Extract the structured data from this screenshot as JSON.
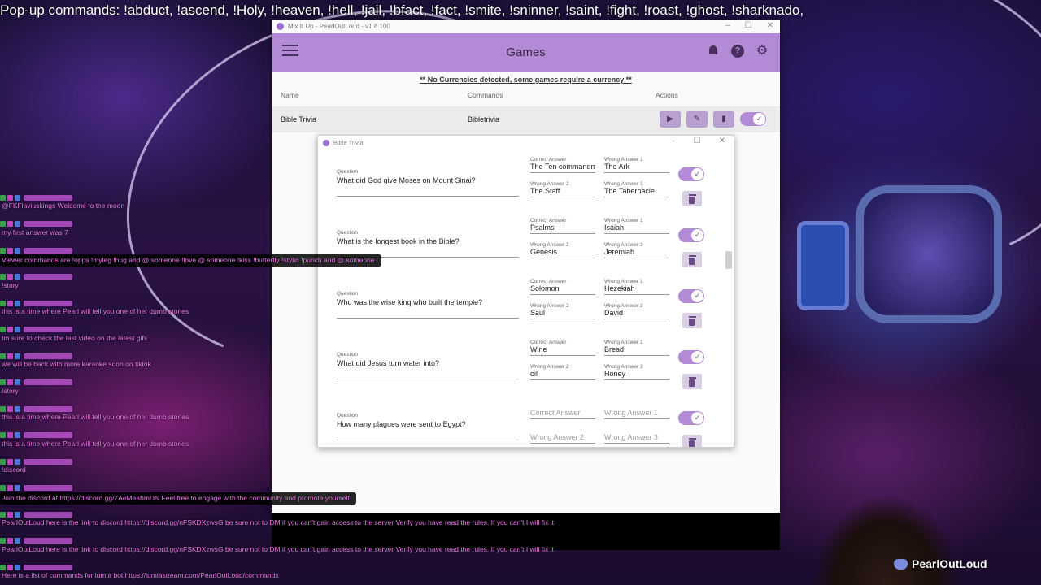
{
  "ticker": "Pop-up commands: !abduct, !ascend, !Holy, !heaven, !hell,  !jail, !bfact, !fact, !smite, !sninner, !saint, !fight, !roast, !ghost, !sharknado,",
  "app": {
    "window_title": "Mix It Up - PearlOutLoud - v1.8.100",
    "header_title": "Games",
    "notice": "** No Currencies detected, some games require a currency **",
    "columns": {
      "name": "Name",
      "commands": "Commands",
      "actions": "Actions"
    },
    "game": {
      "name": "Bible Trivia",
      "command": "Bibletrivia"
    }
  },
  "dialog": {
    "title": "Bible Trivia",
    "labels": {
      "question": "Question",
      "correct": "Correct Answer",
      "wrong1": "Wrong Answer 1",
      "wrong2": "Wrong Answer 2",
      "wrong3": "Wrong Answer 3"
    },
    "questions": [
      {
        "question": "What did God give Moses on Mount Sinai?",
        "correct": "The Ten commandments",
        "wrong1": "The Ark",
        "wrong2": "The Staff",
        "wrong3": "The Tabernacle",
        "enabled": true
      },
      {
        "question": "What is the longest book in the Bible?",
        "correct": "Psalms",
        "wrong1": "Isaiah",
        "wrong2": "Genesis",
        "wrong3": "Jeremiah",
        "enabled": true
      },
      {
        "question": "Who was the wise king who built the temple?",
        "correct": "Solomon",
        "wrong1": "Hezekiah",
        "wrong2": "Saul",
        "wrong3": "David",
        "enabled": true
      },
      {
        "question": "What did Jesus turn water into?",
        "correct": "Wine",
        "wrong1": "Bread",
        "wrong2": "oil",
        "wrong3": "Honey",
        "enabled": true
      },
      {
        "question": "How many plagues were sent to Egypt?",
        "correct": "",
        "wrong1": "",
        "wrong2": "",
        "wrong3": "",
        "enabled": true
      }
    ]
  },
  "chat": [
    {
      "msg": "@FKFlaviuskings Welcome to the moon",
      "dark": false
    },
    {
      "msg": "my first answer was 7",
      "dark": false
    },
    {
      "msg": "Viewer commands are !opps !myleg !hug and @ someone !love @ someone !kiss !butterfly !stylin !punch and @ someone",
      "dark": true
    },
    {
      "msg": "!story",
      "dark": false
    },
    {
      "msg": "this is a time where Pearl will tell you one of her dumb stories",
      "dark": false
    },
    {
      "msg": "Im sure to check the last video on the latest gifs",
      "dark": false
    },
    {
      "msg": "we will be back with more karaoke soon on tiktok",
      "dark": false
    },
    {
      "msg": "!story",
      "dark": false
    },
    {
      "msg": "this is a time where Pearl will tell you one of her dumb stories",
      "dark": false
    },
    {
      "msg": "this is a time where Pearl will tell you one of her dumb stories",
      "dark": false
    },
    {
      "msg": "!discord",
      "dark": false
    },
    {
      "msg": "Join the discord at https://discord.gg/7AeMeahmDN Feel free to engage with the community and promote yourself",
      "dark": true
    },
    {
      "msg": "PearlOutLoud here is the link to discord https://discord.gg/nFSKDXzwsG be sure not to DM if you can't gain access to the server Verify you have read the rules. If you can't I will fix it",
      "dark": false
    },
    {
      "msg": "PearlOutLoud here is the link to discord https://discord.gg/nFSKDXzwsG be sure not to DM if you can't gain access to the server Verify you have read the rules. If you can't I will fix it",
      "dark": false
    },
    {
      "msg": "Here is a list of commands for lumia bot https://lumiastream.com/PearlOutLoud/commands",
      "dark": false
    }
  ],
  "brand": "PearlOutLoud",
  "colors": {
    "accent": "#b38ad6",
    "chat_text": "#e87be8"
  }
}
